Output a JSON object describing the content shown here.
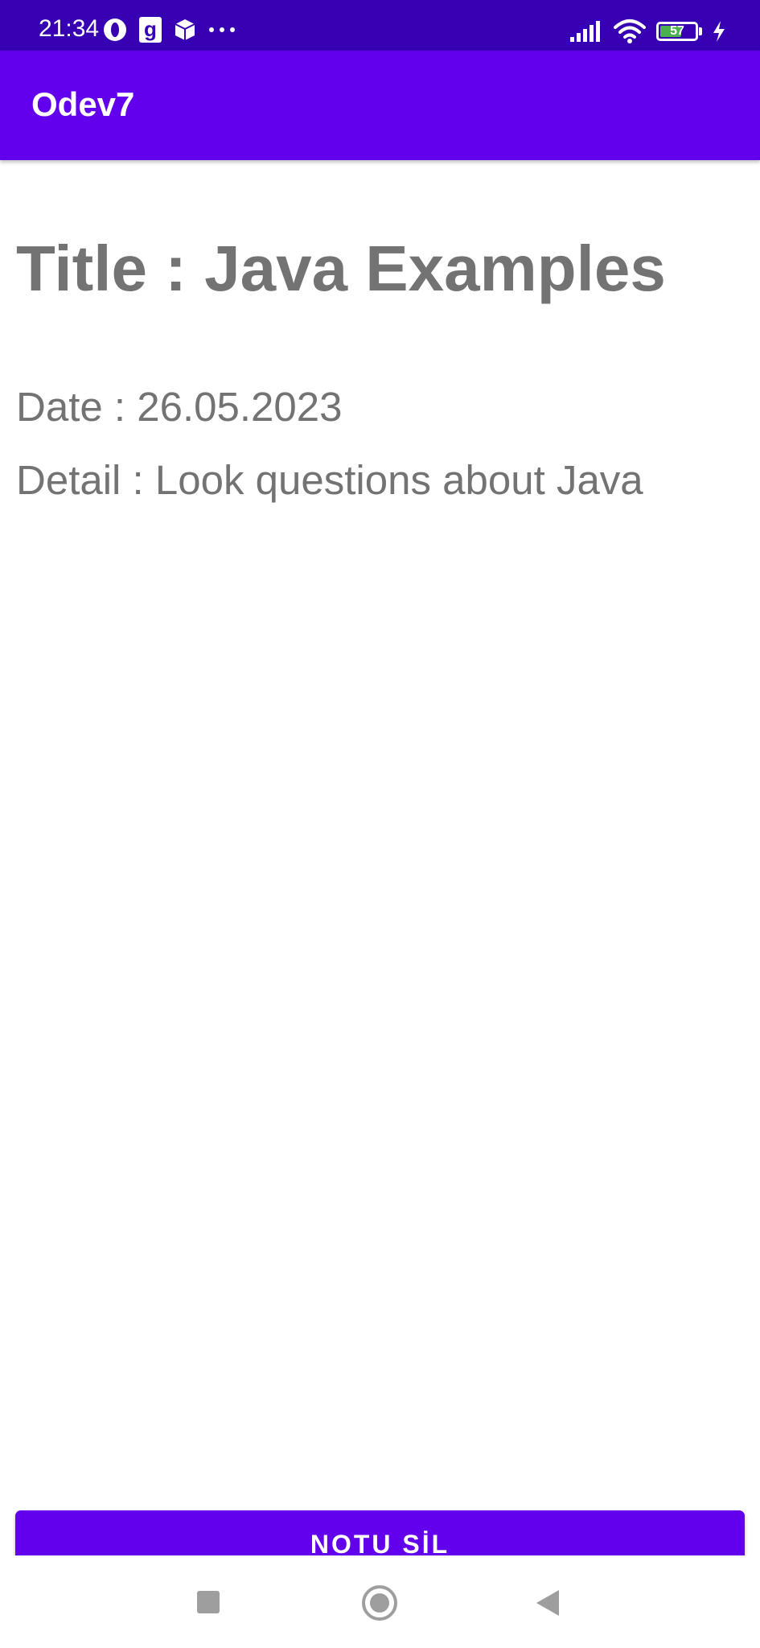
{
  "status_bar": {
    "time": "21:34",
    "battery_level": "57",
    "left_icons": [
      "opera-icon",
      "g-icon",
      "box-icon",
      "more-dots-icon"
    ],
    "right_icons": [
      "signal-icon",
      "wifi-icon",
      "battery-icon",
      "charging-icon"
    ],
    "background_color": "#3700b3"
  },
  "app_bar": {
    "title": "Odev7",
    "background_color": "#6200ee"
  },
  "note": {
    "title": "Title : Java Examples",
    "date": "Date : 26.05.2023",
    "detail": "Detail : Look questions about Java",
    "text_color": "#737373"
  },
  "actions": {
    "delete_label": "NOTU SİL",
    "button_color": "#6200ee"
  },
  "nav_bar": {
    "buttons": [
      "recents-icon",
      "home-icon",
      "back-icon"
    ]
  }
}
